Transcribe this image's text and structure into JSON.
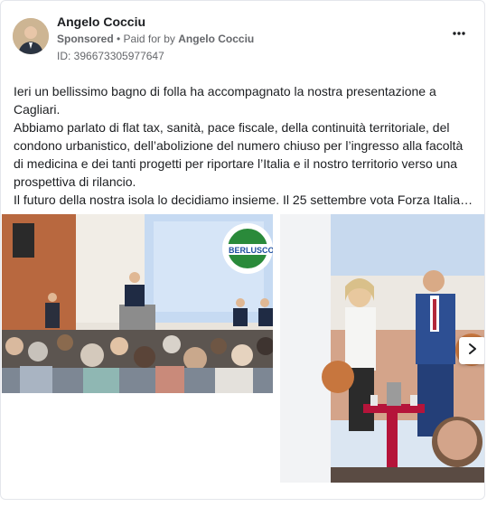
{
  "post": {
    "author": "Angelo Cocciu",
    "sponsored": "Sponsored",
    "paid_for_prefix": " • Paid for by ",
    "paid_for_name": "Angelo Cocciu",
    "ad_id": "ID: 396673305977647",
    "more_icon": "more-options-icon",
    "paragraphs": [
      "Ieri un bellissimo bagno di folla ha accompagnato la nostra presentazione a Cagliari.",
      "Abbiamo parlato di flat tax, sanità, pace fiscale, della continuità territoriale, del condono urbanistico, dell’abolizione del numero chiuso per l’ingresso alla facoltà di medicina e dei tanti progetti per riportare l’Italia e il nostro territorio verso una prospettiva di rilancio.",
      "Il futuro della nostra isola lo decidiamo insieme. Il 25 settembre vota Forza Italia…"
    ],
    "media": {
      "image1_logo_text": "BERLUSCO",
      "next_icon": "chevron-right-icon"
    }
  },
  "colors": {
    "text_primary": "#1c1e21",
    "text_secondary": "#65676b",
    "border": "#e4e6eb"
  }
}
